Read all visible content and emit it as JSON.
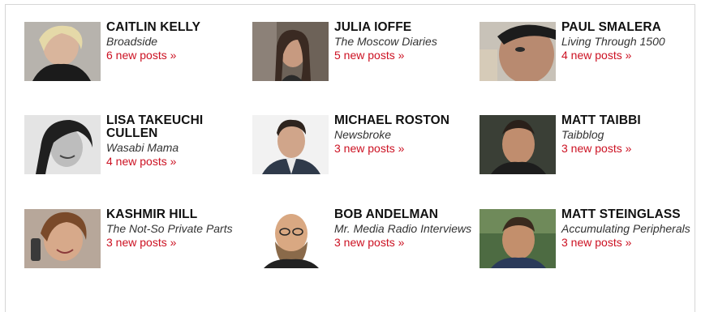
{
  "bloggers": [
    {
      "name": "CAITLIN KELLY",
      "blog": "Broadside",
      "posts": "6 new posts »",
      "photo": "caitlin-kelly-photo"
    },
    {
      "name": "JULIA IOFFE",
      "blog": "The Moscow Diaries",
      "posts": "5 new posts »",
      "photo": "julia-ioffe-photo"
    },
    {
      "name": "PAUL SMALERA",
      "blog": "Living Through 1500",
      "posts": "4 new posts »",
      "photo": "paul-smalera-photo"
    },
    {
      "name": "LISA TAKEUCHI CULLEN",
      "blog": "Wasabi Mama",
      "posts": "4 new posts »",
      "photo": "lisa-takeuchi-cullen-photo"
    },
    {
      "name": "MICHAEL ROSTON",
      "blog": "Newsbroke",
      "posts": "3 new posts »",
      "photo": "michael-roston-photo"
    },
    {
      "name": "MATT TAIBBI",
      "blog": "Taibblog",
      "posts": "3 new posts »",
      "photo": "matt-taibbi-photo"
    },
    {
      "name": "KASHMIR HILL",
      "blog": "The Not-So Private Parts",
      "posts": "3 new posts »",
      "photo": "kashmir-hill-photo"
    },
    {
      "name": "BOB ANDELMAN",
      "blog": "Mr. Media Radio Interviews",
      "posts": "3 new posts »",
      "photo": "bob-andelman-photo"
    },
    {
      "name": "MATT STEINGLASS",
      "blog": "Accumulating Peripherals",
      "posts": "3 new posts »",
      "photo": "matt-steinglass-photo"
    }
  ],
  "colors": {
    "link": "#cc1122",
    "name": "#111111",
    "border": "#d6d6d6"
  }
}
